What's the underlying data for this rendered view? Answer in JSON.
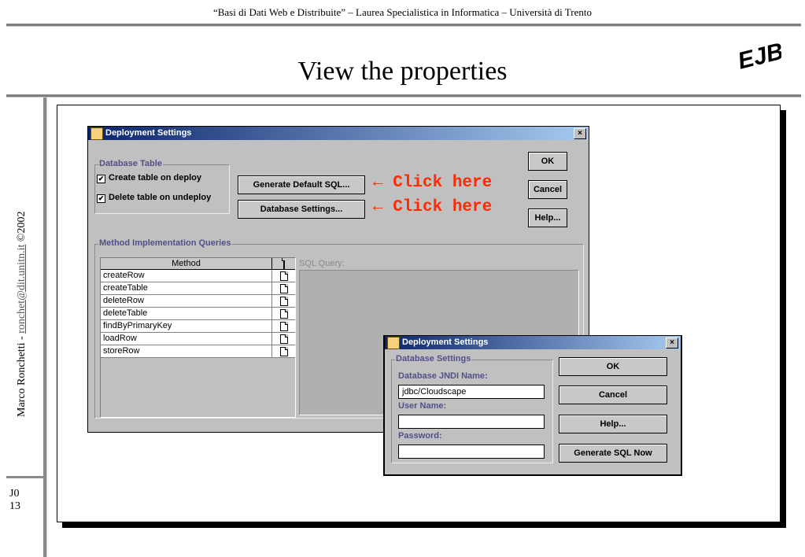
{
  "slide": {
    "header": "“Basi di Dati Web e Distribuite” – Laurea Specialistica in Informatica – Università di Trento",
    "title": "View the properties",
    "logo": "EJB",
    "side_author": "Marco Ronchetti",
    "side_sep": " - ",
    "side_email": "ronchet@dit.unitn.it",
    "side_copy": " ©2002",
    "page_code": "J0",
    "page_num": "13"
  },
  "dialog1": {
    "title": "Deployment Settings",
    "close": "×",
    "database_table": {
      "group": "Database Table",
      "create": "Create table on deploy",
      "delete": "Delete table on undeploy",
      "check": "✔"
    },
    "buttons": {
      "generate": "Generate Default SQL...",
      "db_settings": "Database Settings...",
      "ok": "OK",
      "cancel": "Cancel",
      "help": "Help..."
    },
    "annotation": "← Click here",
    "methods": {
      "group": "Method Implementation Queries",
      "header": "Method",
      "rows": [
        "createRow",
        "createTable",
        "deleteRow",
        "deleteTable",
        "findByPrimaryKey",
        "loadRow",
        "storeRow"
      ]
    },
    "sql_label": "SQL Query:"
  },
  "dialog2": {
    "title": "Deployment Settings",
    "close": "×",
    "group": "Database Settings",
    "jndi_label": "Database JNDI Name:",
    "jndi_value": "jdbc/Cloudscape",
    "user_label": "User Name:",
    "user_value": "",
    "pass_label": "Password:",
    "pass_value": "",
    "buttons": {
      "ok": "OK",
      "cancel": "Cancel",
      "help": "Help...",
      "generate": "Generate SQL Now"
    }
  },
  "colors": {
    "annotation": "#ff2a00",
    "title_bar": "#0a246a",
    "group_label": "#50508a"
  }
}
